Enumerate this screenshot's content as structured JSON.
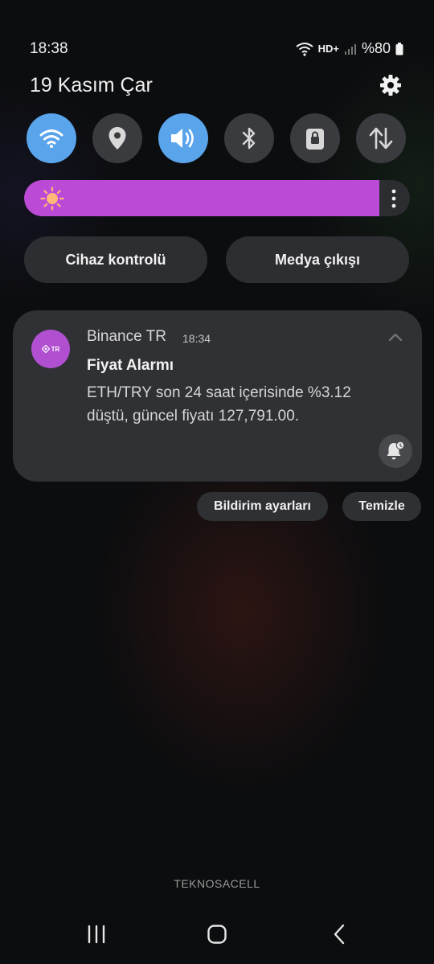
{
  "status_bar": {
    "time": "18:38",
    "network_label": "HD+",
    "battery": "%80",
    "icons": [
      "wifi-icon",
      "hd-voice-icon",
      "signal-icon",
      "battery-icon"
    ]
  },
  "header": {
    "date": "19 Kasım Çar",
    "settings_icon": "gear-icon"
  },
  "quick_tiles": [
    {
      "name": "wifi",
      "icon": "wifi-icon",
      "on": true
    },
    {
      "name": "location",
      "icon": "location-pin-icon",
      "on": false
    },
    {
      "name": "sound",
      "icon": "speaker-icon",
      "on": true
    },
    {
      "name": "bluetooth",
      "icon": "bluetooth-icon",
      "on": false
    },
    {
      "name": "rotation-lock",
      "icon": "lock-icon",
      "on": false
    },
    {
      "name": "mobile-data",
      "icon": "data-arrows-icon",
      "on": false
    }
  ],
  "brightness": {
    "level": 0.92,
    "fill_color": "#bb4bd6",
    "icon": "sun-icon"
  },
  "controls": {
    "device_control": "Cihaz kontrolü",
    "media_output": "Medya çıkışı"
  },
  "notification": {
    "app_icon_text": "TR",
    "app_name": "Binance TR",
    "time": "18:34",
    "title": "Fiyat Alarmı",
    "body": "ETH/TRY son 24 saat içerisinde %3.12 düştü, güncel fiyatı 127,791.00.",
    "accent_color": "#b04fd0"
  },
  "actions": {
    "notification_settings": "Bildirim ayarları",
    "clear": "Temizle"
  },
  "carrier": "TEKNOSACELL",
  "colors": {
    "tile_on": "#5aa4ec",
    "tile_off": "#3a3b3e",
    "card_bg": "#303134"
  }
}
